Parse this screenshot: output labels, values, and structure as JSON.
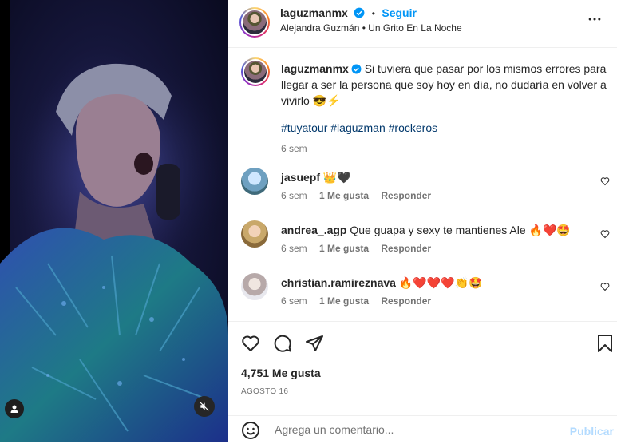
{
  "post": {
    "author": "laguzmanmx",
    "follow_label": "Seguir",
    "audio_line": "Alejandra Guzmán • Un Grito En La Noche",
    "caption_text": "Si tuviera que pasar por los mismos errores para llegar a ser la persona que soy hoy en día, no dudaría en volver a vivirlo 😎⚡",
    "hashtags": "#tuyatour #laguzman #rockeros",
    "caption_time": "6 sem",
    "likes_text": "4,751 Me gusta",
    "date_text": "AGOSTO 16"
  },
  "comments": [
    {
      "user": "jasuepf",
      "text": "👑🖤",
      "time": "6 sem",
      "likes": "1 Me gusta",
      "reply": "Responder"
    },
    {
      "user": "andrea_.agp",
      "text": "Que guapa y sexy te mantienes Ale 🔥❤️🤩",
      "time": "6 sem",
      "likes": "1 Me gusta",
      "reply": "Responder"
    },
    {
      "user": "christian.ramireznava",
      "text": "🔥❤️❤️❤️👏🤩",
      "time": "6 sem",
      "likes": "1 Me gusta",
      "reply": "Responder"
    }
  ],
  "composer": {
    "placeholder": "Agrega un comentario...",
    "publish_label": "Publicar"
  },
  "icons": {
    "more": "more-horizontal-icon",
    "like": "heart-icon",
    "comment": "comment-icon",
    "share": "share-icon",
    "save": "bookmark-icon",
    "emoji": "emoji-icon",
    "mute": "muted-speaker-icon",
    "tag": "user-tag-icon"
  },
  "colors": {
    "link": "#0095f6",
    "hashtag": "#00376b",
    "muted_text": "#737373",
    "publish_disabled": "#b3dbff"
  }
}
